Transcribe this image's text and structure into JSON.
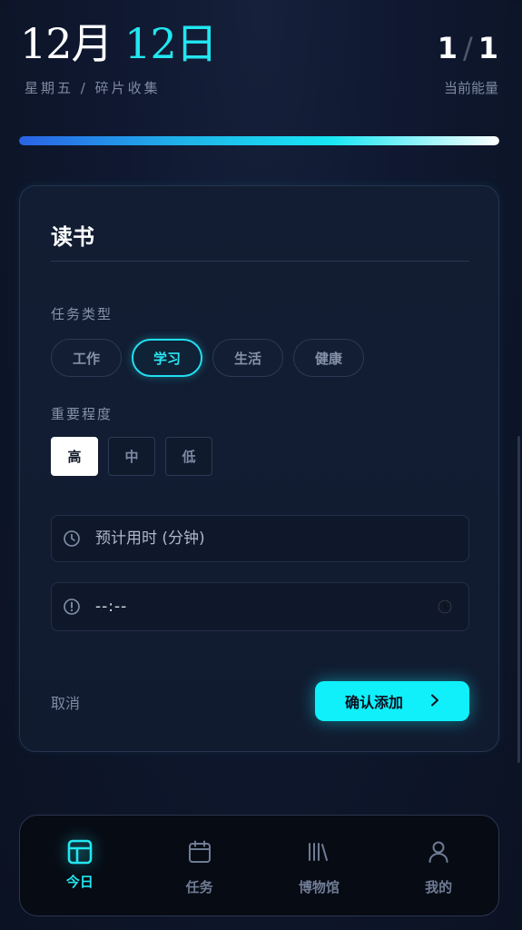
{
  "header": {
    "month": "12月",
    "day": "12日",
    "subtitle": "星期五 / 碎片收集",
    "energy_current": "1",
    "energy_total": "1",
    "energy_label": "当前能量",
    "progress_fraction": 1.0
  },
  "card": {
    "title": "读书",
    "task_type_label": "任务类型",
    "task_types": [
      "工作",
      "学习",
      "生活",
      "健康"
    ],
    "selected_task_type": "学习",
    "priority_label": "重要程度",
    "priorities": [
      "高",
      "中",
      "低"
    ],
    "selected_priority": "高",
    "duration_placeholder": "预计用时 (分钟)",
    "time_value": "--:--",
    "cancel_label": "取消",
    "confirm_label": "确认添加"
  },
  "nav": {
    "items": [
      {
        "label": "今日",
        "icon": "layout-icon",
        "active": true
      },
      {
        "label": "任务",
        "icon": "calendar-icon",
        "active": false
      },
      {
        "label": "博物馆",
        "icon": "library-icon",
        "active": false
      },
      {
        "label": "我的",
        "icon": "user-icon",
        "active": false
      }
    ]
  },
  "colors": {
    "accent": "#22e6f0",
    "background": "#0c1425",
    "confirm_button": "#0ff0fb"
  }
}
